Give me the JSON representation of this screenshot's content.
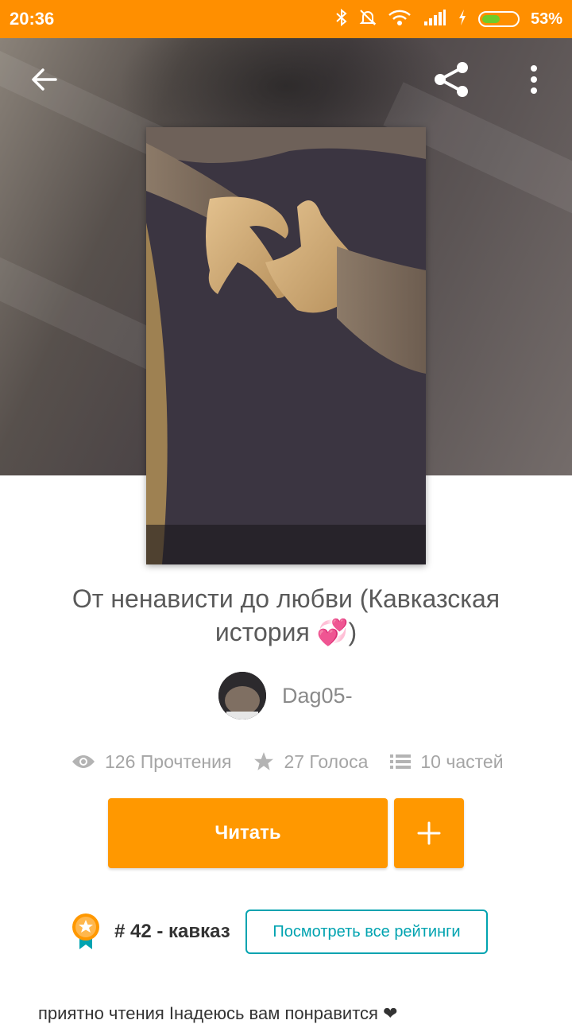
{
  "status_bar": {
    "time": "20:36",
    "battery_percent": "53%"
  },
  "story": {
    "title": "От ненависти до любви (Кавказская история 💞)",
    "author": "Dag05-",
    "stats": {
      "reads": "126 Прочтения",
      "votes": "27 Голоса",
      "parts": "10 частей"
    },
    "description_preview": "приятно чтения Iнадеюсь вам понравится ❤"
  },
  "actions": {
    "read_label": "Читать"
  },
  "ranking": {
    "text": "# 42 - кавказ",
    "view_all_label": "Посмотреть все рейтинги"
  },
  "colors": {
    "accent": "#ff9800",
    "status_bar": "#ff8f00",
    "teal": "#00a3b0"
  }
}
